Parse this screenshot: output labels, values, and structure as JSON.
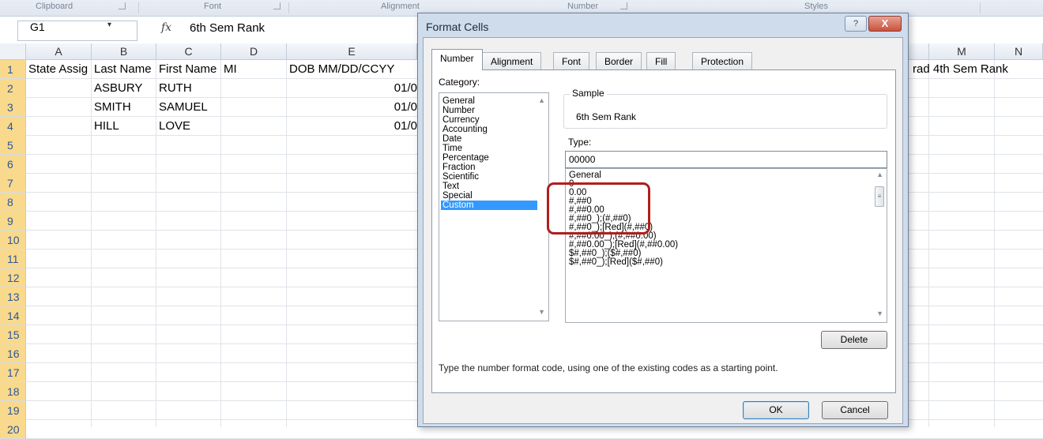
{
  "ribbon": {
    "groups": [
      "Clipboard",
      "Font",
      "Alignment",
      "Number",
      "Styles"
    ]
  },
  "formula_bar": {
    "name_box": "G1",
    "name_box_arrow": "▾",
    "fx_symbol": "fx",
    "value": "6th Sem Rank"
  },
  "sheet": {
    "columns": [
      "A",
      "B",
      "C",
      "D",
      "E",
      "M",
      "N"
    ],
    "rows": [
      "1",
      "2",
      "3",
      "4",
      "5",
      "6",
      "7",
      "8",
      "9",
      "10",
      "11",
      "12",
      "13",
      "14",
      "15",
      "16",
      "17",
      "18",
      "19",
      "20"
    ],
    "header_row": {
      "A": "State Assig",
      "B": "Last Name",
      "C": "First Name",
      "D": "MI",
      "E": "DOB MM/DD/CCYY",
      "L": "rad 4th Sem Rank"
    },
    "data_rows": [
      {
        "B": "ASBURY",
        "C": "RUTH",
        "E": "01/0"
      },
      {
        "B": "SMITH",
        "C": "SAMUEL",
        "E": "01/0"
      },
      {
        "B": "HILL",
        "C": "LOVE",
        "E": "01/0"
      }
    ]
  },
  "dialog": {
    "title": "Format Cells",
    "help_glyph": "?",
    "close_glyph": "X",
    "tabs": [
      "Number",
      "Alignment",
      "Font",
      "Border",
      "Fill",
      "Protection"
    ],
    "active_tab": "Number",
    "category_label": "Category:",
    "categories": [
      "General",
      "Number",
      "Currency",
      "Accounting",
      "Date",
      "Time",
      "Percentage",
      "Fraction",
      "Scientific",
      "Text",
      "Special",
      "Custom"
    ],
    "selected_category": "Custom",
    "sample_label": "Sample",
    "sample_value": "6th Sem Rank",
    "type_label": "Type:",
    "type_value": "00000",
    "type_list": [
      "General",
      "0",
      "0.00",
      "#,##0",
      "#,##0.00",
      "#,##0_);(#,##0)",
      "#,##0_);[Red](#,##0)",
      "#,##0.00_);(#,##0.00)",
      "#,##0.00_);[Red](#,##0.00)",
      "$#,##0_);($#,##0)",
      "$#,##0_);[Red]($#,##0)"
    ],
    "delete_label": "Delete",
    "hint": "Type the number format code, using one of the existing codes as a starting point.",
    "ok_label": "OK",
    "cancel_label": "Cancel",
    "highlight_color": "#b11e1e",
    "selection_color": "#3399ff"
  }
}
